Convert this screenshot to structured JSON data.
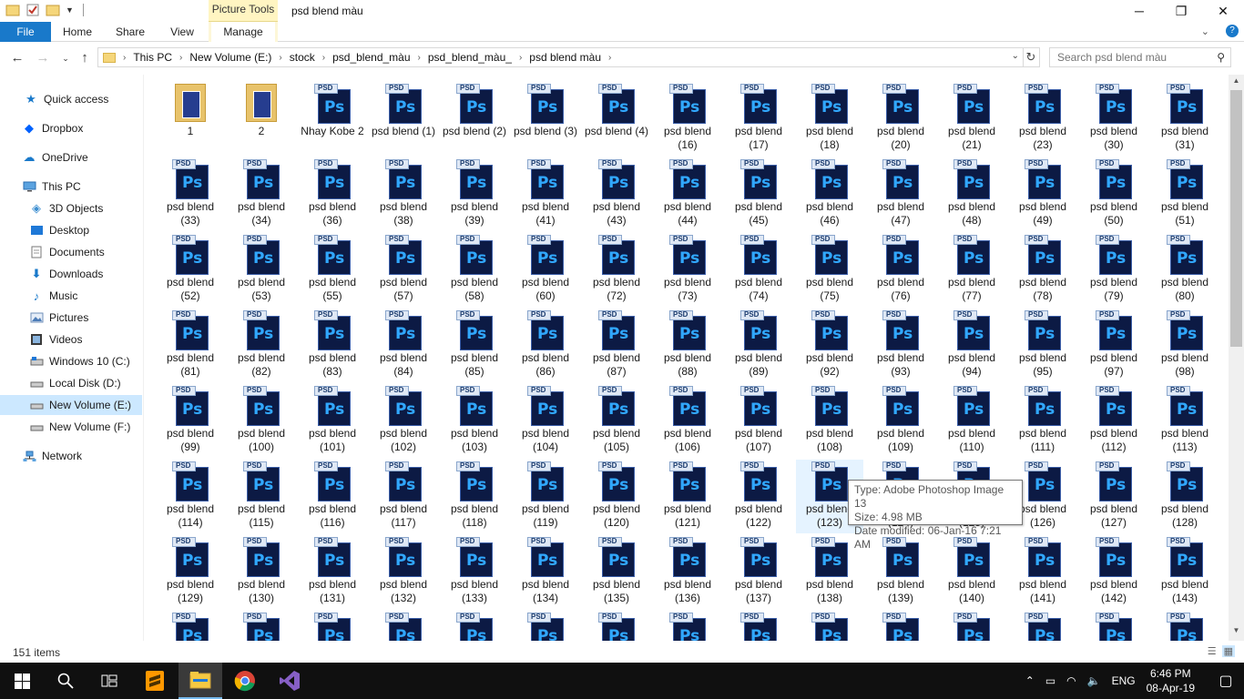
{
  "window": {
    "title": "psd blend màu",
    "context_tab": "Picture Tools",
    "controls": [
      "─",
      "❐",
      "✕"
    ]
  },
  "ribbon": {
    "tabs": [
      "File",
      "Home",
      "Share",
      "View",
      "Manage"
    ]
  },
  "address": {
    "crumbs": [
      "This PC",
      "New Volume (E:)",
      "stock",
      "psd_blend_màu",
      "psd_blend_màu_",
      "psd blend màu"
    ]
  },
  "search": {
    "placeholder": "Search psd blend màu"
  },
  "nav": {
    "items": [
      {
        "label": "Quick access",
        "icon": "star-icon"
      },
      {
        "label": "Dropbox",
        "icon": "dropbox-icon"
      },
      {
        "label": "OneDrive",
        "icon": "cloud-icon"
      },
      {
        "label": "This PC",
        "icon": "computer-icon"
      },
      {
        "label": "3D Objects",
        "icon": "cube-icon"
      },
      {
        "label": "Desktop",
        "icon": "desktop-icon"
      },
      {
        "label": "Documents",
        "icon": "document-icon"
      },
      {
        "label": "Downloads",
        "icon": "download-icon"
      },
      {
        "label": "Music",
        "icon": "music-icon"
      },
      {
        "label": "Pictures",
        "icon": "pictures-icon"
      },
      {
        "label": "Videos",
        "icon": "video-icon"
      },
      {
        "label": "Windows 10 (C:)",
        "icon": "drive-icon"
      },
      {
        "label": "Local Disk (D:)",
        "icon": "drive-icon"
      },
      {
        "label": "New Volume (E:)",
        "icon": "drive-icon"
      },
      {
        "label": "New Volume (F:)",
        "icon": "drive-icon"
      },
      {
        "label": "Network",
        "icon": "network-icon"
      }
    ],
    "selected": "New Volume (E:)"
  },
  "files": [
    {
      "name": "1",
      "kind": "folder"
    },
    {
      "name": "2",
      "kind": "folder"
    },
    {
      "name": "Nhay Kobe 2",
      "kind": "psd"
    },
    {
      "name": "psd blend (1)",
      "kind": "psd"
    },
    {
      "name": "psd blend (2)",
      "kind": "psd"
    },
    {
      "name": "psd blend (3)",
      "kind": "psd"
    },
    {
      "name": "psd blend (4)",
      "kind": "psd"
    },
    {
      "name": "psd blend (16)",
      "kind": "psd"
    },
    {
      "name": "psd blend (17)",
      "kind": "psd"
    },
    {
      "name": "psd blend (18)",
      "kind": "psd"
    },
    {
      "name": "psd blend (20)",
      "kind": "psd"
    },
    {
      "name": "psd blend (21)",
      "kind": "psd"
    },
    {
      "name": "psd blend (23)",
      "kind": "psd"
    },
    {
      "name": "psd blend (30)",
      "kind": "psd"
    },
    {
      "name": "psd blend (31)",
      "kind": "psd"
    },
    {
      "name": "psd blend (33)",
      "kind": "psd"
    },
    {
      "name": "psd blend (34)",
      "kind": "psd"
    },
    {
      "name": "psd blend (36)",
      "kind": "psd"
    },
    {
      "name": "psd blend (38)",
      "kind": "psd"
    },
    {
      "name": "psd blend (39)",
      "kind": "psd"
    },
    {
      "name": "psd blend (41)",
      "kind": "psd"
    },
    {
      "name": "psd blend (43)",
      "kind": "psd"
    },
    {
      "name": "psd blend (44)",
      "kind": "psd"
    },
    {
      "name": "psd blend (45)",
      "kind": "psd"
    },
    {
      "name": "psd blend (46)",
      "kind": "psd"
    },
    {
      "name": "psd blend (47)",
      "kind": "psd"
    },
    {
      "name": "psd blend (48)",
      "kind": "psd"
    },
    {
      "name": "psd blend (49)",
      "kind": "psd"
    },
    {
      "name": "psd blend (50)",
      "kind": "psd"
    },
    {
      "name": "psd blend (51)",
      "kind": "psd"
    },
    {
      "name": "psd blend (52)",
      "kind": "psd"
    },
    {
      "name": "psd blend (53)",
      "kind": "psd"
    },
    {
      "name": "psd blend (55)",
      "kind": "psd"
    },
    {
      "name": "psd blend (57)",
      "kind": "psd"
    },
    {
      "name": "psd blend (58)",
      "kind": "psd"
    },
    {
      "name": "psd blend (60)",
      "kind": "psd"
    },
    {
      "name": "psd blend (72)",
      "kind": "psd"
    },
    {
      "name": "psd blend (73)",
      "kind": "psd"
    },
    {
      "name": "psd blend (74)",
      "kind": "psd"
    },
    {
      "name": "psd blend (75)",
      "kind": "psd"
    },
    {
      "name": "psd blend (76)",
      "kind": "psd"
    },
    {
      "name": "psd blend (77)",
      "kind": "psd"
    },
    {
      "name": "psd blend (78)",
      "kind": "psd"
    },
    {
      "name": "psd blend (79)",
      "kind": "psd"
    },
    {
      "name": "psd blend (80)",
      "kind": "psd"
    },
    {
      "name": "psd blend (81)",
      "kind": "psd"
    },
    {
      "name": "psd blend (82)",
      "kind": "psd"
    },
    {
      "name": "psd blend (83)",
      "kind": "psd"
    },
    {
      "name": "psd blend (84)",
      "kind": "psd"
    },
    {
      "name": "psd blend (85)",
      "kind": "psd"
    },
    {
      "name": "psd blend (86)",
      "kind": "psd"
    },
    {
      "name": "psd blend (87)",
      "kind": "psd"
    },
    {
      "name": "psd blend (88)",
      "kind": "psd"
    },
    {
      "name": "psd blend (89)",
      "kind": "psd"
    },
    {
      "name": "psd blend (92)",
      "kind": "psd"
    },
    {
      "name": "psd blend (93)",
      "kind": "psd"
    },
    {
      "name": "psd blend (94)",
      "kind": "psd"
    },
    {
      "name": "psd blend (95)",
      "kind": "psd"
    },
    {
      "name": "psd blend (97)",
      "kind": "psd"
    },
    {
      "name": "psd blend (98)",
      "kind": "psd"
    },
    {
      "name": "psd blend (99)",
      "kind": "psd"
    },
    {
      "name": "psd blend (100)",
      "kind": "psd"
    },
    {
      "name": "psd blend (101)",
      "kind": "psd"
    },
    {
      "name": "psd blend (102)",
      "kind": "psd"
    },
    {
      "name": "psd blend (103)",
      "kind": "psd"
    },
    {
      "name": "psd blend (104)",
      "kind": "psd"
    },
    {
      "name": "psd blend (105)",
      "kind": "psd"
    },
    {
      "name": "psd blend (106)",
      "kind": "psd"
    },
    {
      "name": "psd blend (107)",
      "kind": "psd"
    },
    {
      "name": "psd blend (108)",
      "kind": "psd"
    },
    {
      "name": "psd blend (109)",
      "kind": "psd"
    },
    {
      "name": "psd blend (110)",
      "kind": "psd"
    },
    {
      "name": "psd blend (111)",
      "kind": "psd"
    },
    {
      "name": "psd blend (112)",
      "kind": "psd"
    },
    {
      "name": "psd blend (113)",
      "kind": "psd"
    },
    {
      "name": "psd blend (114)",
      "kind": "psd"
    },
    {
      "name": "psd blend (115)",
      "kind": "psd"
    },
    {
      "name": "psd blend (116)",
      "kind": "psd"
    },
    {
      "name": "psd blend (117)",
      "kind": "psd"
    },
    {
      "name": "psd blend (118)",
      "kind": "psd"
    },
    {
      "name": "psd blend (119)",
      "kind": "psd"
    },
    {
      "name": "psd blend (120)",
      "kind": "psd"
    },
    {
      "name": "psd blend (121)",
      "kind": "psd"
    },
    {
      "name": "psd blend (122)",
      "kind": "psd"
    },
    {
      "name": "psd blend (123)",
      "kind": "psd",
      "hover": true
    },
    {
      "name": "psd blend (124)",
      "kind": "psd"
    },
    {
      "name": "psd blend (125)",
      "kind": "psd"
    },
    {
      "name": "psd blend (126)",
      "kind": "psd"
    },
    {
      "name": "psd blend (127)",
      "kind": "psd"
    },
    {
      "name": "psd blend (128)",
      "kind": "psd"
    },
    {
      "name": "psd blend (129)",
      "kind": "psd"
    },
    {
      "name": "psd blend (130)",
      "kind": "psd"
    },
    {
      "name": "psd blend (131)",
      "kind": "psd"
    },
    {
      "name": "psd blend (132)",
      "kind": "psd"
    },
    {
      "name": "psd blend (133)",
      "kind": "psd"
    },
    {
      "name": "psd blend (134)",
      "kind": "psd"
    },
    {
      "name": "psd blend (135)",
      "kind": "psd"
    },
    {
      "name": "psd blend (136)",
      "kind": "psd"
    },
    {
      "name": "psd blend (137)",
      "kind": "psd"
    },
    {
      "name": "psd blend (138)",
      "kind": "psd"
    },
    {
      "name": "psd blend (139)",
      "kind": "psd"
    },
    {
      "name": "psd blend (140)",
      "kind": "psd"
    },
    {
      "name": "psd blend (141)",
      "kind": "psd"
    },
    {
      "name": "psd blend (142)",
      "kind": "psd"
    },
    {
      "name": "psd blend (143)",
      "kind": "psd"
    },
    {
      "name": "",
      "kind": "psd"
    },
    {
      "name": "",
      "kind": "psd"
    },
    {
      "name": "",
      "kind": "psd"
    },
    {
      "name": "",
      "kind": "psd"
    },
    {
      "name": "",
      "kind": "psd"
    },
    {
      "name": "",
      "kind": "psd"
    },
    {
      "name": "",
      "kind": "psd"
    },
    {
      "name": "",
      "kind": "psd"
    },
    {
      "name": "",
      "kind": "psd"
    },
    {
      "name": "",
      "kind": "psd"
    },
    {
      "name": "",
      "kind": "psd"
    },
    {
      "name": "",
      "kind": "psd"
    },
    {
      "name": "",
      "kind": "psd"
    },
    {
      "name": "",
      "kind": "psd"
    },
    {
      "name": "",
      "kind": "psd"
    }
  ],
  "tooltip": {
    "type": "Type: Adobe Photoshop Image 13",
    "size": "Size: 4.98 MB",
    "date": "Date modified: 06-Jan-16 7:21 AM"
  },
  "status": {
    "count": "151 items"
  },
  "taskbar": {
    "apps": [
      "start-icon",
      "search-icon",
      "task-view-icon",
      "sublime-icon",
      "file-explorer-icon",
      "chrome-icon",
      "visual-studio-icon"
    ],
    "active": "file-explorer-icon",
    "language": "ENG",
    "time": "6:46 PM",
    "date": "08-Apr-19"
  },
  "colors": {
    "accent": "#1979ca",
    "selection": "#cce8ff",
    "hover": "#e5f3ff",
    "context_tab": "#fff5c2",
    "taskbar": "#101010"
  }
}
